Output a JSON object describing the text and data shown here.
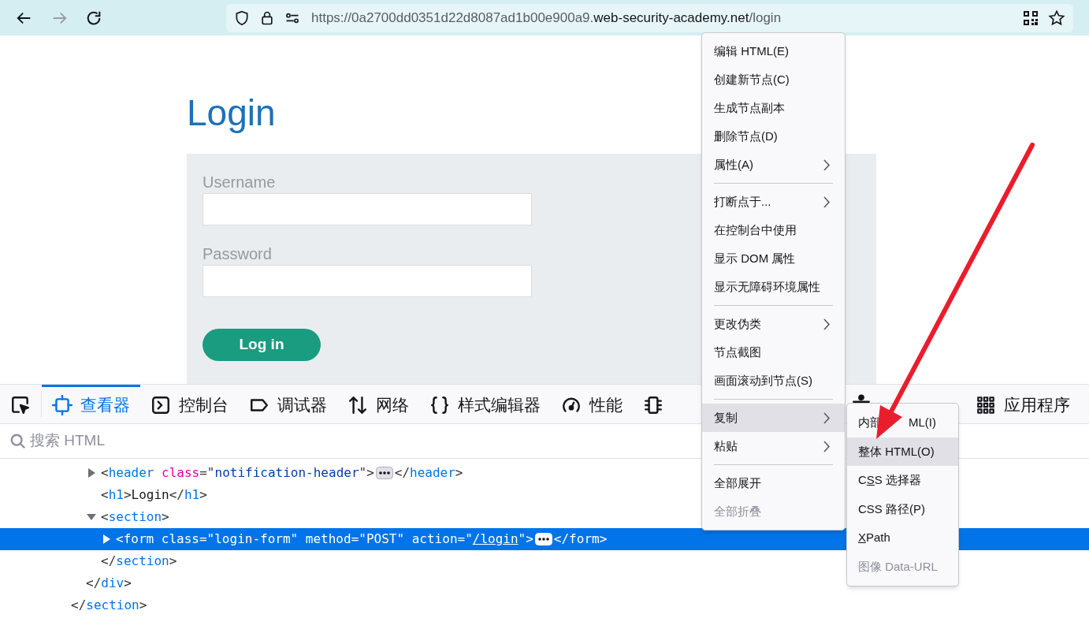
{
  "browser": {
    "url": {
      "prefix": "https://0a2700dd0351d22d8087ad1b00e900a9.",
      "domain": "web-security-academy.net",
      "path": "/login"
    }
  },
  "page": {
    "title": "Login",
    "fields": [
      {
        "label": "Username"
      },
      {
        "label": "Password"
      }
    ],
    "button": "Log in"
  },
  "devtools": {
    "tabs": [
      {
        "kind": "picker",
        "selected": false
      },
      {
        "kind": "inspector",
        "label": "查看器",
        "selected": true
      },
      {
        "kind": "console",
        "label": "控制台",
        "selected": false
      },
      {
        "kind": "debugger",
        "label": "调试器",
        "selected": false
      },
      {
        "kind": "network",
        "label": "网络",
        "selected": false
      },
      {
        "kind": "style",
        "label": "样式编辑器",
        "selected": false
      },
      {
        "kind": "performance",
        "label": "性能",
        "selected": false
      },
      {
        "kind": "memory",
        "selected": false
      },
      {
        "kind": "accessibility",
        "selected": false
      },
      {
        "kind": "application",
        "label": "应用程序",
        "selected": false
      }
    ],
    "search": {
      "placeholder": "搜索 HTML"
    },
    "tree": [
      {
        "selected": false,
        "close": [
          {
            "kind": "bracket",
            "text": "</"
          },
          {
            "kind": "tag",
            "text": "section"
          },
          {
            "kind": "bracket",
            "text": ">"
          }
        ],
        "children": [
          {
            "selected": false,
            "close": [
              {
                "kind": "bracket",
                "text": "</"
              },
              {
                "kind": "tag",
                "text": "div"
              },
              {
                "kind": "bracket",
                "text": ">"
              }
            ],
            "children": [
              {
                "selected": false,
                "expanded": false,
                "open": [
                  {
                    "kind": "bracket",
                    "text": "<"
                  },
                  {
                    "kind": "tag",
                    "text": "header"
                  },
                  {
                    "kind": "attr",
                    "text": " class"
                  },
                  {
                    "kind": "bracket",
                    "text": "=\""
                  },
                  {
                    "kind": "value",
                    "text": "notification-header"
                  },
                  {
                    "kind": "bracket",
                    "text": "\">"
                  },
                  {
                    "kind": "more"
                  },
                  {
                    "kind": "bracket",
                    "text": "</"
                  },
                  {
                    "kind": "tag",
                    "text": "header"
                  },
                  {
                    "kind": "bracket",
                    "text": ">"
                  }
                ]
              },
              {
                "selected": false,
                "open": [
                  {
                    "kind": "bracket",
                    "text": "<"
                  },
                  {
                    "kind": "tag",
                    "text": "h1"
                  },
                  {
                    "kind": "bracket",
                    "text": ">"
                  },
                  {
                    "kind": "text",
                    "text": "Login"
                  },
                  {
                    "kind": "bracket",
                    "text": "</"
                  },
                  {
                    "kind": "tag",
                    "text": "h1"
                  },
                  {
                    "kind": "bracket",
                    "text": ">"
                  }
                ]
              },
              {
                "selected": false,
                "expanded": true,
                "open": [
                  {
                    "kind": "bracket",
                    "text": "<"
                  },
                  {
                    "kind": "tag",
                    "text": "section"
                  },
                  {
                    "kind": "bracket",
                    "text": ">"
                  }
                ],
                "close": [
                  {
                    "kind": "bracket",
                    "text": "</"
                  },
                  {
                    "kind": "tag",
                    "text": "section"
                  },
                  {
                    "kind": "bracket",
                    "text": ">"
                  }
                ],
                "children": [
                  {
                    "selected": true,
                    "expanded": false,
                    "open": [
                      {
                        "kind": "bracket",
                        "text": "<"
                      },
                      {
                        "kind": "tag",
                        "text": "form"
                      },
                      {
                        "kind": "attr",
                        "text": " class"
                      },
                      {
                        "kind": "bracket",
                        "text": "=\""
                      },
                      {
                        "kind": "value",
                        "text": "login-form"
                      },
                      {
                        "kind": "bracket",
                        "text": "\""
                      },
                      {
                        "kind": "attr",
                        "text": " method"
                      },
                      {
                        "kind": "bracket",
                        "text": "=\""
                      },
                      {
                        "kind": "value",
                        "text": "POST"
                      },
                      {
                        "kind": "bracket",
                        "text": "\""
                      },
                      {
                        "kind": "attr",
                        "text": " action"
                      },
                      {
                        "kind": "bracket",
                        "text": "=\""
                      },
                      {
                        "kind": "link",
                        "text": "/login"
                      },
                      {
                        "kind": "bracket",
                        "text": "\">"
                      },
                      {
                        "kind": "more"
                      },
                      {
                        "kind": "bracket",
                        "text": "</"
                      },
                      {
                        "kind": "tag",
                        "text": "form"
                      },
                      {
                        "kind": "bracket",
                        "text": ">"
                      }
                    ]
                  }
                ]
              }
            ]
          }
        ]
      }
    ]
  },
  "context_menu": {
    "items": [
      {
        "kind": "item",
        "label": "编辑 HTML(E)",
        "submenu": false,
        "disabled": false,
        "selected": false
      },
      {
        "kind": "item",
        "label": "创建新节点(C)",
        "submenu": false,
        "disabled": false,
        "selected": false
      },
      {
        "kind": "item",
        "label": "生成节点副本",
        "submenu": false,
        "disabled": false,
        "selected": false
      },
      {
        "kind": "item",
        "label": "删除节点(D)",
        "submenu": false,
        "disabled": false,
        "selected": false
      },
      {
        "kind": "item",
        "label": "属性(A)",
        "submenu": true,
        "disabled": false,
        "selected": false
      },
      {
        "kind": "separator"
      },
      {
        "kind": "item",
        "label": "打断点于...",
        "submenu": true,
        "disabled": false,
        "selected": false
      },
      {
        "kind": "item",
        "label": "在控制台中使用",
        "submenu": false,
        "disabled": false,
        "selected": false
      },
      {
        "kind": "item",
        "label": "显示 DOM 属性",
        "submenu": false,
        "disabled": false,
        "selected": false
      },
      {
        "kind": "item",
        "label": "显示无障碍环境属性",
        "submenu": false,
        "disabled": false,
        "selected": false
      },
      {
        "kind": "separator"
      },
      {
        "kind": "item",
        "label": "更改伪类",
        "submenu": true,
        "disabled": false,
        "selected": false
      },
      {
        "kind": "item",
        "label": "节点截图",
        "submenu": false,
        "disabled": false,
        "selected": false
      },
      {
        "kind": "item",
        "label": "画面滚动到节点(S)",
        "submenu": false,
        "disabled": false,
        "selected": false
      },
      {
        "kind": "separator"
      },
      {
        "kind": "item",
        "label": "复制",
        "submenu": true,
        "disabled": false,
        "selected": true
      },
      {
        "kind": "item",
        "label": "粘贴",
        "submenu": true,
        "disabled": false,
        "selected": false
      },
      {
        "kind": "separator"
      },
      {
        "kind": "item",
        "label": "全部展开",
        "submenu": false,
        "disabled": false,
        "selected": false
      },
      {
        "kind": "item",
        "label": "全部折叠",
        "submenu": false,
        "disabled": true,
        "selected": false
      }
    ]
  },
  "submenu": {
    "items": [
      {
        "label": "内部",
        "tail": "ML(I)",
        "disabled": false,
        "selected": false
      },
      {
        "label": "整体 HTML(O)",
        "disabled": false,
        "selected": true
      },
      {
        "label": "C",
        "key": "S",
        "after": "S 选择器",
        "disabled": false,
        "selected": false
      },
      {
        "label": "CSS 路径(P)",
        "disabled": false,
        "selected": false
      },
      {
        "key": "X",
        "after": "Path",
        "disabled": false,
        "selected": false
      },
      {
        "label": "图像 Data-URL",
        "disabled": true,
        "selected": false
      }
    ]
  }
}
